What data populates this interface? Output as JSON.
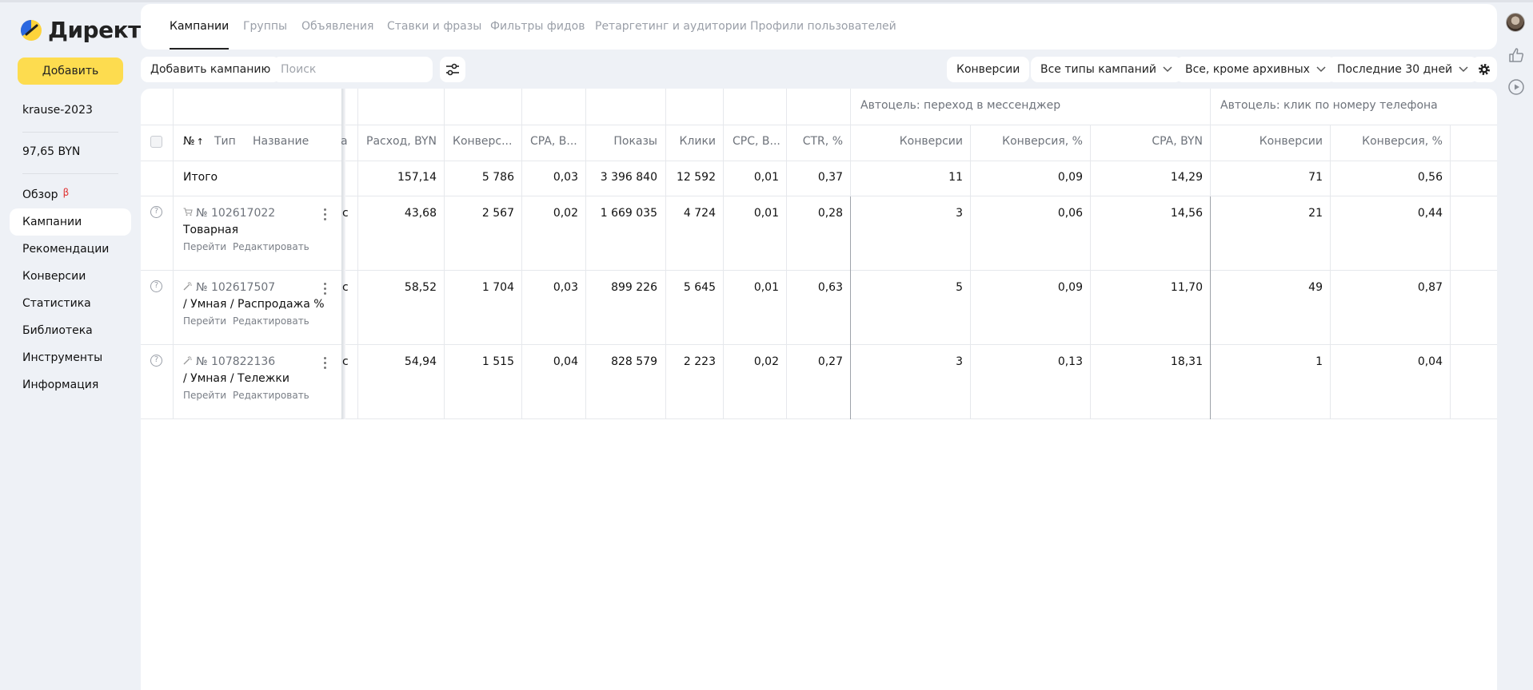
{
  "app": {
    "logo_text": "Директ",
    "add_button": "Добавить",
    "account": "krause-2023",
    "balance": "97,65 BYN"
  },
  "nav": [
    {
      "label": "Обзор",
      "badge": "β"
    },
    {
      "label": "Кампании",
      "active": true
    },
    {
      "label": "Рекомендации"
    },
    {
      "label": "Конверсии"
    },
    {
      "label": "Статистика"
    },
    {
      "label": "Библиотека"
    },
    {
      "label": "Инструменты"
    },
    {
      "label": "Информация"
    }
  ],
  "tabs": [
    {
      "label": "Кампании",
      "active": true
    },
    {
      "label": "Группы"
    },
    {
      "label": "Объявления"
    },
    {
      "label": "Ставки и фразы"
    },
    {
      "label": "Фильтры фидов"
    },
    {
      "label": "Ретаргетинг и аудитории"
    },
    {
      "label": "Профили пользователей"
    }
  ],
  "toolbar": {
    "add_campaign": "Добавить кампанию",
    "search_placeholder": "Поиск",
    "conversions": "Конверсии",
    "campaign_types": "Все типы кампаний",
    "status_filter": "Все, кроме архивных",
    "period": "Последние 30 дней"
  },
  "table": {
    "groups": {
      "messenger": "Автоцель: переход в мессенджер",
      "phone": "Автоцель: клик по номеру телефона"
    },
    "headers": {
      "num": "№",
      "sort_arrow": "↑",
      "type": "Тип",
      "name": "Название",
      "clipped": "а",
      "spend": "Расход, BYN",
      "conv": "Конверс...",
      "cpa": "CPA, B...",
      "impressions": "Показы",
      "clicks": "Клики",
      "cpc": "CPC, B...",
      "ctr": "CTR, %",
      "m_conv": "Конверсии",
      "m_rate": "Конверсия, %",
      "m_cpa": "CPA, BYN",
      "p_conv": "Конверсии",
      "p_rate": "Конверсия, %"
    },
    "total": {
      "label": "Итого",
      "spend": "157,14",
      "conv": "5 786",
      "cpa": "0,03",
      "impressions": "3 396 840",
      "clicks": "12 592",
      "cpc": "0,01",
      "ctr": "0,37",
      "m_conv": "11",
      "m_rate": "0,09",
      "m_cpa": "14,29",
      "p_conv": "71",
      "p_rate": "0,56"
    },
    "rows": [
      {
        "id": "№ 102617022",
        "name": "Товарная",
        "icon": "cart-icon",
        "link_go": "Перейти",
        "link_edit": "Редактировать",
        "clipped": "с",
        "spend": "43,68",
        "conv": "2 567",
        "cpa": "0,02",
        "impressions": "1 669 035",
        "clicks": "4 724",
        "cpc": "0,01",
        "ctr": "0,28",
        "m_conv": "3",
        "m_rate": "0,06",
        "m_cpa": "14,56",
        "p_conv": "21",
        "p_rate": "0,44"
      },
      {
        "id": "№ 102617507",
        "name": "/ Умная / Распродажа %",
        "icon": "smart-icon",
        "link_go": "Перейти",
        "link_edit": "Редактировать",
        "clipped": "с",
        "spend": "58,52",
        "conv": "1 704",
        "cpa": "0,03",
        "impressions": "899 226",
        "clicks": "5 645",
        "cpc": "0,01",
        "ctr": "0,63",
        "m_conv": "5",
        "m_rate": "0,09",
        "m_cpa": "11,70",
        "p_conv": "49",
        "p_rate": "0,87"
      },
      {
        "id": "№ 107822136",
        "name": "/ Умная / Тележки",
        "icon": "smart-icon",
        "link_go": "Перейти",
        "link_edit": "Редактировать",
        "clipped": "с",
        "spend": "54,94",
        "conv": "1 515",
        "cpa": "0,04",
        "impressions": "828 579",
        "clicks": "2 223",
        "cpc": "0,02",
        "ctr": "0,27",
        "m_conv": "3",
        "m_rate": "0,13",
        "m_cpa": "18,31",
        "p_conv": "1",
        "p_rate": "0,04"
      }
    ]
  }
}
